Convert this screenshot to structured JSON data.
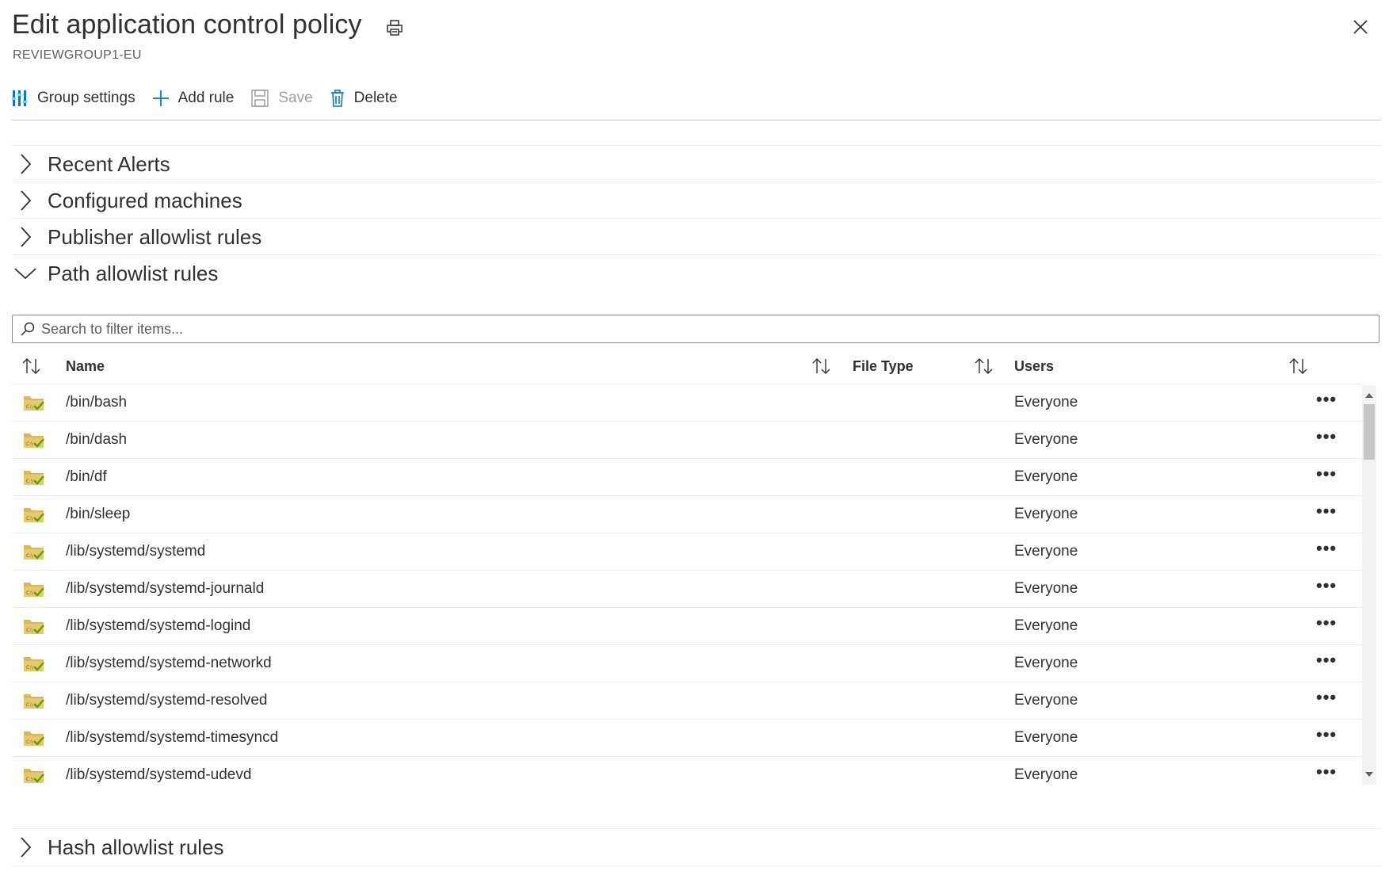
{
  "header": {
    "title": "Edit application control policy",
    "subtitle": "REVIEWGROUP1-EU"
  },
  "toolbar": {
    "group_settings": "Group settings",
    "add_rule": "Add rule",
    "save": "Save",
    "delete": "Delete"
  },
  "sections": {
    "recent_alerts": "Recent Alerts",
    "configured_machines": "Configured machines",
    "publisher_rules": "Publisher allowlist rules",
    "path_rules": "Path allowlist rules",
    "hash_rules": "Hash allowlist rules"
  },
  "search": {
    "placeholder": "Search to filter items..."
  },
  "table": {
    "columns": {
      "name": "Name",
      "file_type": "File Type",
      "users": "Users"
    },
    "rows": [
      {
        "name": "/bin/bash",
        "file_type": "",
        "users": "Everyone"
      },
      {
        "name": "/bin/dash",
        "file_type": "",
        "users": "Everyone"
      },
      {
        "name": "/bin/df",
        "file_type": "",
        "users": "Everyone"
      },
      {
        "name": "/bin/sleep",
        "file_type": "",
        "users": "Everyone"
      },
      {
        "name": "/lib/systemd/systemd",
        "file_type": "",
        "users": "Everyone"
      },
      {
        "name": "/lib/systemd/systemd-journald",
        "file_type": "",
        "users": "Everyone"
      },
      {
        "name": "/lib/systemd/systemd-logind",
        "file_type": "",
        "users": "Everyone"
      },
      {
        "name": "/lib/systemd/systemd-networkd",
        "file_type": "",
        "users": "Everyone"
      },
      {
        "name": "/lib/systemd/systemd-resolved",
        "file_type": "",
        "users": "Everyone"
      },
      {
        "name": "/lib/systemd/systemd-timesyncd",
        "file_type": "",
        "users": "Everyone"
      },
      {
        "name": "/lib/systemd/systemd-udevd",
        "file_type": "",
        "users": "Everyone"
      }
    ],
    "row_more_label": "•••"
  },
  "colors": {
    "accent": "#0078d4",
    "folder": "#d8b65a",
    "check": "#57a300"
  },
  "icons": {
    "print": "print-icon",
    "close": "close-icon",
    "group_settings": "group-settings-icon",
    "add": "plus-icon",
    "save": "save-icon",
    "delete": "trash-icon",
    "search": "search-icon",
    "sort": "sort-icon",
    "folder": "folder-check-icon",
    "chevron_right": "chevron-right-icon",
    "chevron_down": "chevron-down-icon"
  }
}
